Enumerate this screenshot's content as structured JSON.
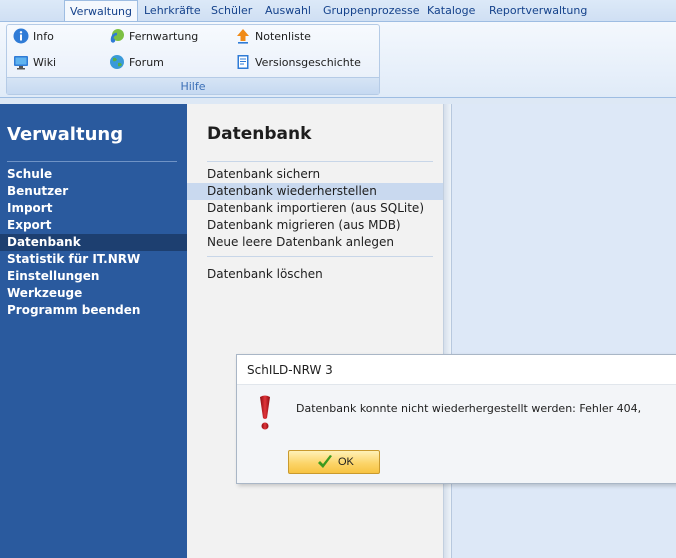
{
  "ribbon": {
    "tabs": [
      {
        "label": "Verwaltung",
        "active": true
      },
      {
        "label": "Lehrkräfte"
      },
      {
        "label": "Schüler"
      },
      {
        "label": "Auswahl"
      },
      {
        "label": "Gruppenprozesse"
      },
      {
        "label": "Kataloge"
      },
      {
        "label": "Reportverwaltung"
      }
    ],
    "group": {
      "label": "Hilfe",
      "buttons": [
        {
          "label": "Info",
          "icon": "info-icon"
        },
        {
          "label": "Fernwartung",
          "icon": "remote-support-icon"
        },
        {
          "label": "Notenliste",
          "icon": "upload-arrow-icon"
        },
        {
          "label": "Wiki",
          "icon": "monitor-icon"
        },
        {
          "label": "Forum",
          "icon": "globe-icon"
        },
        {
          "label": "Versionsgeschichte",
          "icon": "document-icon"
        }
      ]
    }
  },
  "nav": {
    "title": "Verwaltung",
    "items": [
      {
        "label": "Schule"
      },
      {
        "label": "Benutzer"
      },
      {
        "label": "Import"
      },
      {
        "label": "Export"
      },
      {
        "label": "Datenbank",
        "active": true
      },
      {
        "label": "Statistik für IT.NRW"
      },
      {
        "label": "Einstellungen"
      },
      {
        "label": "Werkzeuge"
      },
      {
        "label": "Programm beenden"
      }
    ]
  },
  "panel": {
    "title": "Datenbank",
    "items": [
      {
        "label": "Datenbank sichern"
      },
      {
        "label": "Datenbank wiederherstellen",
        "active": true
      },
      {
        "label": "Datenbank importieren (aus SQLite)"
      },
      {
        "label": "Datenbank migrieren (aus MDB)"
      },
      {
        "label": "Neue leere Datenbank anlegen"
      },
      {
        "label": "Datenbank löschen"
      }
    ]
  },
  "dialog": {
    "title": "SchILD-NRW 3",
    "message": "Datenbank konnte nicht wiederhergestellt werden: Fehler 404,",
    "ok_label": "OK",
    "icon": "exclamation-icon"
  },
  "colors": {
    "nav_bg": "#2a5a9e",
    "nav_active": "#1d3f70",
    "panel_active": "#c9d9ef",
    "ok_button": "#fcd56a",
    "alert_red": "#c0131a"
  }
}
